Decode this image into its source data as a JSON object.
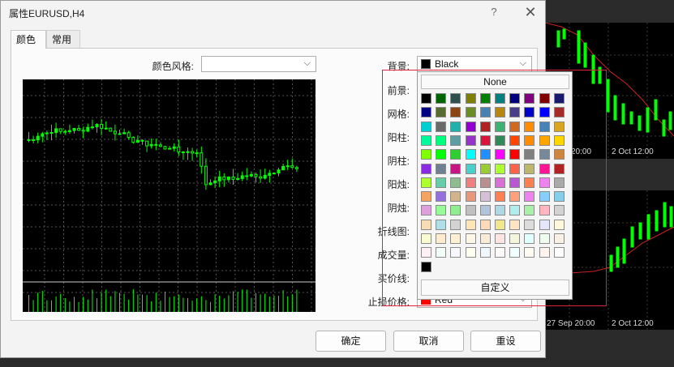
{
  "window": {
    "title": "属性EURUSD,H4",
    "help_label": "?",
    "close_label": "✕"
  },
  "tabs": [
    {
      "label": "颜色",
      "active": true
    },
    {
      "label": "常用",
      "active": false
    }
  ],
  "color_scheme": {
    "label": "颜色风格:",
    "value": ""
  },
  "fields": [
    {
      "label": "背景:",
      "value": "Black",
      "color": "#000000"
    },
    {
      "label": "前景:"
    },
    {
      "label": "网格:"
    },
    {
      "label": "阳柱:"
    },
    {
      "label": "阴柱:"
    },
    {
      "label": "阳烛:"
    },
    {
      "label": "阴烛:"
    },
    {
      "label": "折线图:"
    },
    {
      "label": "成交量:"
    },
    {
      "label": "买价线:"
    },
    {
      "label": "止损价格:",
      "value": "Red",
      "color": "#ff0000"
    }
  ],
  "color_popup": {
    "none_label": "None",
    "custom_label": "自定义",
    "selected_color": "#000000",
    "rows": [
      [
        "#000000",
        "#006400",
        "#2f4f4f",
        "#808000",
        "#008000",
        "#008080",
        "#000080",
        "#800080",
        "#800000",
        "#191970"
      ],
      [
        "#000080",
        "#556b2f",
        "#8b4513",
        "#6b8e23",
        "#4682b4",
        "#b8860b",
        "#483d8b",
        "#0000cd",
        "#0000ff",
        "#a52a2a"
      ],
      [
        "#00ced1",
        "#696969",
        "#20b2aa",
        "#9400d3",
        "#b22222",
        "#3cb371",
        "#d2691e",
        "#ff8c00",
        "#4682b4",
        "#daa520"
      ],
      [
        "#00fa9a",
        "#00ff7f",
        "#5f9ea0",
        "#9932cc",
        "#dc143c",
        "#2e8b57",
        "#ff4500",
        "#ff8c00",
        "#ffa500",
        "#ffd700"
      ],
      [
        "#7fff00",
        "#00ff00",
        "#32cd32",
        "#00ffff",
        "#1e90ff",
        "#ff00ff",
        "#ff0000",
        "#808080",
        "#778899",
        "#cd853f"
      ],
      [
        "#8a2be2",
        "#708090",
        "#c71585",
        "#48d1cc",
        "#9acd32",
        "#adff2f",
        "#ff6347",
        "#bdb76b",
        "#ff1493",
        "#b22222"
      ],
      [
        "#adff2f",
        "#66cdaa",
        "#8fbc8f",
        "#f08080",
        "#bc8f8f",
        "#da70d6",
        "#ba55d3",
        "#ff7f50",
        "#ee82ee",
        "#a9a9a9"
      ],
      [
        "#f4a460",
        "#9370db",
        "#d2b48c",
        "#e9967a",
        "#d8bfd8",
        "#ff7f50",
        "#ffa07a",
        "#ee82ee",
        "#87cefa",
        "#87ceeb"
      ],
      [
        "#dda0dd",
        "#98fb98",
        "#90ee90",
        "#c0c0c0",
        "#b0c4de",
        "#add8e6",
        "#afeeee",
        "#a9f0a9",
        "#ffb6c1",
        "#d3d3d3"
      ],
      [
        "#f5deb3",
        "#b0e0e6",
        "#d3d3d3",
        "#ffe4b5",
        "#ffdab9",
        "#f0e68c",
        "#ffe4c4",
        "#dcdcdc",
        "#e6e6fa",
        "#fff8dc"
      ],
      [
        "#fafad2",
        "#ffebcd",
        "#ffefd5",
        "#fdf5e6",
        "#faebd7",
        "#ffe4e1",
        "#f5f5dc",
        "#e0ffff",
        "#f0fff0",
        "#faf0e6"
      ],
      [
        "#fff0f5",
        "#f5fffa",
        "#f8f8ff",
        "#fffff0",
        "#f0f8ff",
        "#fffafa",
        "#f0ffff",
        "#fffaf0",
        "#fff5ee",
        "#ffffff"
      ],
      [
        "#000000"
      ]
    ]
  },
  "buttons": {
    "ok": "确定",
    "cancel": "取消",
    "reset": "重设"
  },
  "background_chart": {
    "time_labels": [
      "20:00",
      "2 Oct 12:00",
      "27 Sep 20:00",
      "2 Oct 12:00"
    ]
  }
}
